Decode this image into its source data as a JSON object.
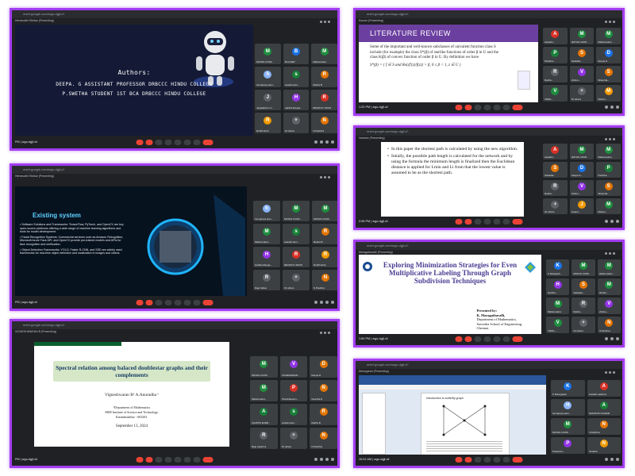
{
  "panels": {
    "p1": {
      "url": "meet.google.com/wgo-dgjf-c!!",
      "presenter": "Hemavathi Shekar (Presenting)",
      "authors_heading": "Authors:",
      "author_line1": "Deepa. G Assistant professor DRBCCC Hindu college",
      "author_line2": "P.Swetha student 1st BCA DRBCCC Hindu college",
      "time": "PM | wgo-dgjf-cli",
      "tiles": [
        {
          "initial": "M",
          "name": "MATHS CONF...",
          "color": "#1e8e3e"
        },
        {
          "initial": "B",
          "name": "BCA DEP",
          "color": "#1a73e8"
        },
        {
          "initial": "M",
          "name": "Mathematics",
          "color": "#1e8e3e"
        },
        {
          "initial": "h",
          "name": "hemapriya elan...",
          "color": "#8ab4f8"
        },
        {
          "initial": "s",
          "name": "swasthi.asm...",
          "color": "#188038"
        },
        {
          "initial": "R",
          "name": "Rekha B",
          "color": "#e37400"
        },
        {
          "initial": "J",
          "name": "Jayalakshmi V...",
          "color": "#5f6368"
        },
        {
          "initial": "H",
          "name": "Haritha Ranga...",
          "color": "#9334e6"
        },
        {
          "initial": "R",
          "name": "REVATHY ARUN",
          "color": "#d93025"
        },
        {
          "initial": "R",
          "name": "Rohith ECA",
          "color": "#f29900"
        },
        {
          "initial": "+",
          "name": "33 others",
          "color": "#5f6368"
        },
        {
          "initial": "N",
          "name": "N.Pavithra",
          "color": "#e37400"
        }
      ]
    },
    "p2": {
      "url": "meet.google.com/wgo-dgjf-c!!",
      "presenter": "Sourav (Presenting)",
      "heading": "LITERATURE REVIEW",
      "body": "Some of the important and well-known subclasses of univalent function class S include (for example) the class S*(β) of starlike functions of order β in U and the class K(β) of convex function of order β in U. By definition we have",
      "formula": "S*(β) = { f ∈ S and Re(zf′(z)/f(z)) > β, 0 ≤ β < 1, z ∈ U }",
      "time": "1:20 PM | wgo-dgjf-cli",
      "tiles": [
        {
          "initial": "A",
          "name": "Aswathi...",
          "color": "#d93025"
        },
        {
          "initial": "M",
          "name": "MATHS CONF...",
          "color": "#1e8e3e"
        },
        {
          "initial": "M",
          "name": "Mathematics...",
          "color": "#1e8e3e"
        },
        {
          "initial": "P",
          "name": "Pavithra...",
          "color": "#188038"
        },
        {
          "initial": "S",
          "name": "Sasikala...",
          "color": "#e37400"
        },
        {
          "initial": "D",
          "name": "Deepa S",
          "color": "#1a73e8"
        },
        {
          "initial": "R",
          "name": "Rekha...",
          "color": "#5f6368"
        },
        {
          "initial": "V",
          "name": "Vishnu...",
          "color": "#9334e6"
        },
        {
          "initial": "S",
          "name": "Sharmila...",
          "color": "#e37400"
        },
        {
          "initial": "V",
          "name": "VIMAL...",
          "color": "#1e8e3e"
        },
        {
          "initial": "+",
          "name": "20 others",
          "color": "#5f6368"
        },
        {
          "initial": "M",
          "name": "Mohan...",
          "color": "#f29900"
        }
      ]
    },
    "p3": {
      "url": "meet.google.com/wgo-dgjf-c!!",
      "presenter": "Hemavathi Shekar (Presenting)",
      "heading": "Existing system",
      "bullets": [
        "Software Solutions and Frameworks: TensorFlow, PyTorch, and OpenCV are key open-source platforms offering a wide range of machine learning algorithms and tools for model development.",
        "Facial Recognition Systems: Commercial services such as Amazon Rekognition, Microsoft Azure Face API, and OpenCV provide pre-trained models and APIs for face recognition and verification.",
        "Object Detection Frameworks: YOLO, Faster R-CNN, and SSD are widely used frameworks for real-time object detection and localization in images and videos."
      ],
      "time": "PM | wgo-dgjf-cli",
      "tiles": [
        {
          "initial": "h",
          "name": "hemapriya elan...",
          "color": "#8ab4f8"
        },
        {
          "initial": "M",
          "name": "MATHS CONF...",
          "color": "#1e8e3e"
        },
        {
          "initial": "M",
          "name": "MATHS CONF...",
          "color": "#1e8e3e"
        },
        {
          "initial": "M",
          "name": "Mathematics...",
          "color": "#1e8e3e"
        },
        {
          "initial": "s",
          "name": "swasthi.asm...",
          "color": "#188038"
        },
        {
          "initial": "R",
          "name": "Rekha B",
          "color": "#e37400"
        },
        {
          "initial": "H",
          "name": "Haritha Ranga...",
          "color": "#9334e6"
        },
        {
          "initial": "R",
          "name": "REVATHY ARUN",
          "color": "#d93025"
        },
        {
          "initial": "R",
          "name": "Rohith ECA",
          "color": "#f29900"
        },
        {
          "initial": "R",
          "name": "Raju Sahar",
          "color": "#5f6368"
        },
        {
          "initial": "+",
          "name": "31 others",
          "color": "#5f6368"
        },
        {
          "initial": "N",
          "name": "N.Pavithra",
          "color": "#e37400"
        }
      ]
    },
    "p4": {
      "url": "meet.google.com/wgo-dgjf-c!!",
      "presenter": "Vamsee (Presenting)",
      "bullet1": "In this paper the shortest path is calculated by using the new algorithm.",
      "bullet2": "Intially, the possible path length is calculated for the network and by using the formula the minimum length is finalized then the Euclidean distance is applied for Lmin and Li from that the lowest value is assumed to be as the shortest path.",
      "time": "2:08 PM | wgo-dgjf-cli",
      "tiles": [
        {
          "initial": "A",
          "name": "Aswathi...",
          "color": "#d93025"
        },
        {
          "initial": "M",
          "name": "MATHS CONF...",
          "color": "#1e8e3e"
        },
        {
          "initial": "M",
          "name": "Mathematics...",
          "color": "#1e8e3e"
        },
        {
          "initial": "S",
          "name": "Sasikala...",
          "color": "#e37400"
        },
        {
          "initial": "D",
          "name": "Deepa S...",
          "color": "#1a73e8"
        },
        {
          "initial": "P",
          "name": "Pavithra...",
          "color": "#188038"
        },
        {
          "initial": "R",
          "name": "Rekha...",
          "color": "#5f6368"
        },
        {
          "initial": "V",
          "name": "Vishnu...",
          "color": "#9334e6"
        },
        {
          "initial": "S",
          "name": "Sharmila...",
          "color": "#e37400"
        },
        {
          "initial": "+",
          "name": "22 others",
          "color": "#5f6368"
        },
        {
          "initial": "J",
          "name": "Janani...",
          "color": "#f29900"
        },
        {
          "initial": "M",
          "name": "Mohan...",
          "color": "#1e8e3e"
        }
      ]
    },
    "p5": {
      "url": "meet.google.com/wgo-dgjf-c!!",
      "presenter": "VIGNESHWARAN B (Presenting)",
      "title": "Spectral relation among balaced doublestar graphs and their complements",
      "authors": "Vigneshwaran B¹   A.Anuradha ¹",
      "affiliation1": "¹Department of Mathematics",
      "affiliation2": "SRM Institute of Science and Technology,",
      "affiliation3": "Kattankulathur - 603203.",
      "date": "September 13, 2024",
      "time": "PM | wgo-dgjf-cli",
      "tiles": [
        {
          "initial": "M",
          "name": "MATHS CONF...",
          "color": "#1e8e3e"
        },
        {
          "initial": "V",
          "name": "VIGNESHWAR...",
          "color": "#9334e6"
        },
        {
          "initial": "D",
          "name": "Deepa R",
          "color": "#e37400"
        },
        {
          "initial": "M",
          "name": "Mathematics...",
          "color": "#1e8e3e"
        },
        {
          "initial": "P",
          "name": "PrlaniNarasim...",
          "color": "#d93025"
        },
        {
          "initial": "N",
          "name": "Nivedha R",
          "color": "#e37400"
        },
        {
          "initial": "A",
          "name": "AGAPPA ECEB...",
          "color": "#188038"
        },
        {
          "initial": "s",
          "name": "swasthi.asm...",
          "color": "#188038"
        },
        {
          "initial": "R",
          "name": "Rekha B",
          "color": "#e37400"
        },
        {
          "initial": "R",
          "name": "Raju Lakshmi",
          "color": "#5f6368"
        },
        {
          "initial": "+",
          "name": "46 others",
          "color": "#5f6368"
        },
        {
          "initial": "N",
          "name": "N.Pavithra",
          "color": "#e37400"
        }
      ]
    },
    "p6": {
      "url": "meet.google.com/wgo-dgjf-c!!",
      "presenter": "Maragathavalli (Presenting)",
      "title": "Exploring Minimization Strategies for Even Multiplicative Labeling Through Graph Subdivision Techniques",
      "presented_by": "Presented by:",
      "presenter_name": "K. Maragathavalli,",
      "dept": "Department of Mathematics,",
      "school": "Saveetha School of Engineering,",
      "city": "Chennai.",
      "time": "1:50 PM | wgo-dgjf-cli",
      "tiles": [
        {
          "initial": "K",
          "name": "K Maragath...",
          "color": "#1a73e8"
        },
        {
          "initial": "M",
          "name": "MATHS CONF...",
          "color": "#1e8e3e"
        },
        {
          "initial": "M",
          "name": "Mathematics...",
          "color": "#1e8e3e"
        },
        {
          "initial": "H",
          "name": "Haritha...",
          "color": "#9334e6"
        },
        {
          "initial": "S",
          "name": "Sasikala...",
          "color": "#e37400"
        },
        {
          "initial": "M",
          "name": "Mohan...",
          "color": "#1e8e3e"
        },
        {
          "initial": "M",
          "name": "Mathematics",
          "color": "#1e8e3e"
        },
        {
          "initial": "R",
          "name": "Rekha...",
          "color": "#5f6368"
        },
        {
          "initial": "V",
          "name": "Vishnu...",
          "color": "#9334e6"
        },
        {
          "initial": "V",
          "name": "VIMAL...",
          "color": "#1e8e3e"
        },
        {
          "initial": "+",
          "name": "24 others",
          "color": "#5f6368"
        },
        {
          "initial": "N",
          "name": "N.Pavithra",
          "color": "#e37400"
        }
      ]
    },
    "p7": {
      "url": "meet.google.com/wgo-dgjf-c!!",
      "presenter": "Manogaran (Presenting)",
      "doc_title": "Introduction to butterfly graph",
      "time": "10:01 AM | wgo-dgjf-cli",
      "tiles": [
        {
          "initial": "K",
          "name": "K Manogaran",
          "color": "#1a73e8"
        },
        {
          "initial": "A",
          "name": "Aswathi Lakshmi",
          "color": "#d93025"
        },
        {
          "initial": "H",
          "name": "hemapriya elan...",
          "color": "#8ab4f8"
        },
        {
          "initial": "A",
          "name": "ARAVINTH KUMAR",
          "color": "#188038"
        },
        {
          "initial": "M",
          "name": "MATHS CONF...",
          "color": "#1e8e3e"
        },
        {
          "initial": "N",
          "name": "N.Pavithra",
          "color": "#e37400"
        },
        {
          "initial": "P",
          "name": "Prasanna...",
          "color": "#9334e6"
        },
        {
          "initial": "N",
          "name": "Nivedha",
          "color": "#f29900"
        }
      ]
    }
  }
}
